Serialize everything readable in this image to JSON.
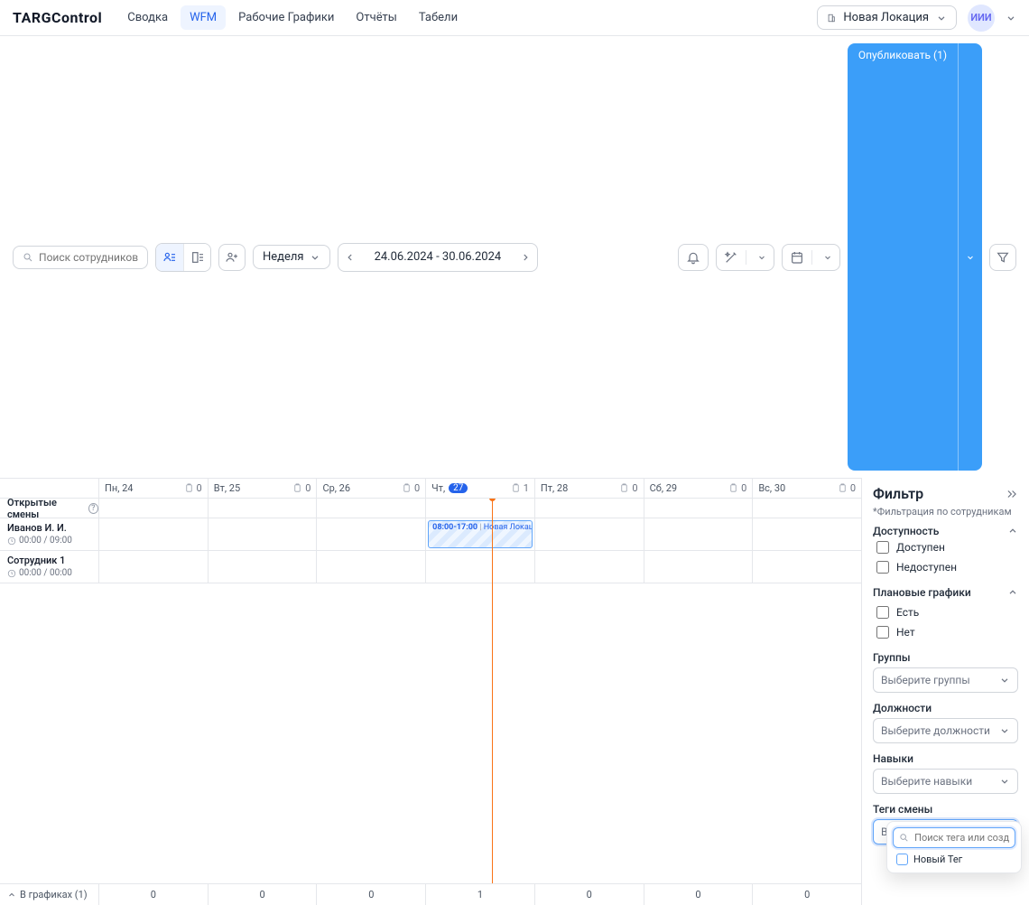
{
  "brand": "TARGControl",
  "nav": {
    "items": [
      {
        "label": "Сводка",
        "active": false
      },
      {
        "label": "WFM",
        "active": true
      },
      {
        "label": "Рабочие Графики",
        "active": false
      },
      {
        "label": "Отчёты",
        "active": false
      },
      {
        "label": "Табели",
        "active": false
      }
    ]
  },
  "location": {
    "label": "Новая Локация"
  },
  "avatar": "ИИИ",
  "toolbar": {
    "search_placeholder": "Поиск сотрудников",
    "period": "Неделя",
    "range": "24.06.2024 - 30.06.2024",
    "publish": "Опубликовать (1)"
  },
  "schedule": {
    "days": [
      {
        "label": "Пн, 24",
        "count": "0",
        "current": false
      },
      {
        "label": "Вт, 25",
        "count": "0",
        "current": false
      },
      {
        "label": "Ср, 26",
        "count": "0",
        "current": false
      },
      {
        "label_prefix": "Чт,",
        "label_day": "27",
        "count": "1",
        "current": true
      },
      {
        "label": "Пт, 28",
        "count": "0",
        "current": false
      },
      {
        "label": "Сб, 29",
        "count": "0",
        "current": false
      },
      {
        "label": "Вс, 30",
        "count": "0",
        "current": false
      }
    ],
    "open_shifts_label": "Открытые смены",
    "now_line_percent": 51.5,
    "rows": [
      {
        "name": "Иванов И. И.",
        "hours": "00:00 / 09:00",
        "shifts": [
          {
            "day_index": 3,
            "time": "08:00-17:00",
            "loc": "Новая Локация"
          }
        ]
      },
      {
        "name": "Сотрудник 1",
        "hours": "00:00 / 00:00",
        "shifts": []
      }
    ],
    "footer_label": "В графиках (1)",
    "footer_counts": [
      "0",
      "0",
      "0",
      "1",
      "0",
      "0",
      "0"
    ]
  },
  "filter": {
    "title": "Фильтр",
    "subtitle": "*Фильтрация по сотрудникам",
    "availability": {
      "title": "Доступность",
      "opts": [
        "Доступен",
        "Недоступен"
      ]
    },
    "planned": {
      "title": "Плановые графики",
      "opts": [
        "Есть",
        "Нет"
      ]
    },
    "groups": {
      "title": "Группы",
      "placeholder": "Выберите группы"
    },
    "positions": {
      "title": "Должности",
      "placeholder": "Выберите должности"
    },
    "skills": {
      "title": "Навыки",
      "placeholder": "Выберите навыки"
    },
    "tags": {
      "title": "Теги смены",
      "placeholder": "Выберите теги",
      "search_placeholder": "Поиск тега или создайте",
      "options": [
        "Новый Тег"
      ]
    }
  }
}
